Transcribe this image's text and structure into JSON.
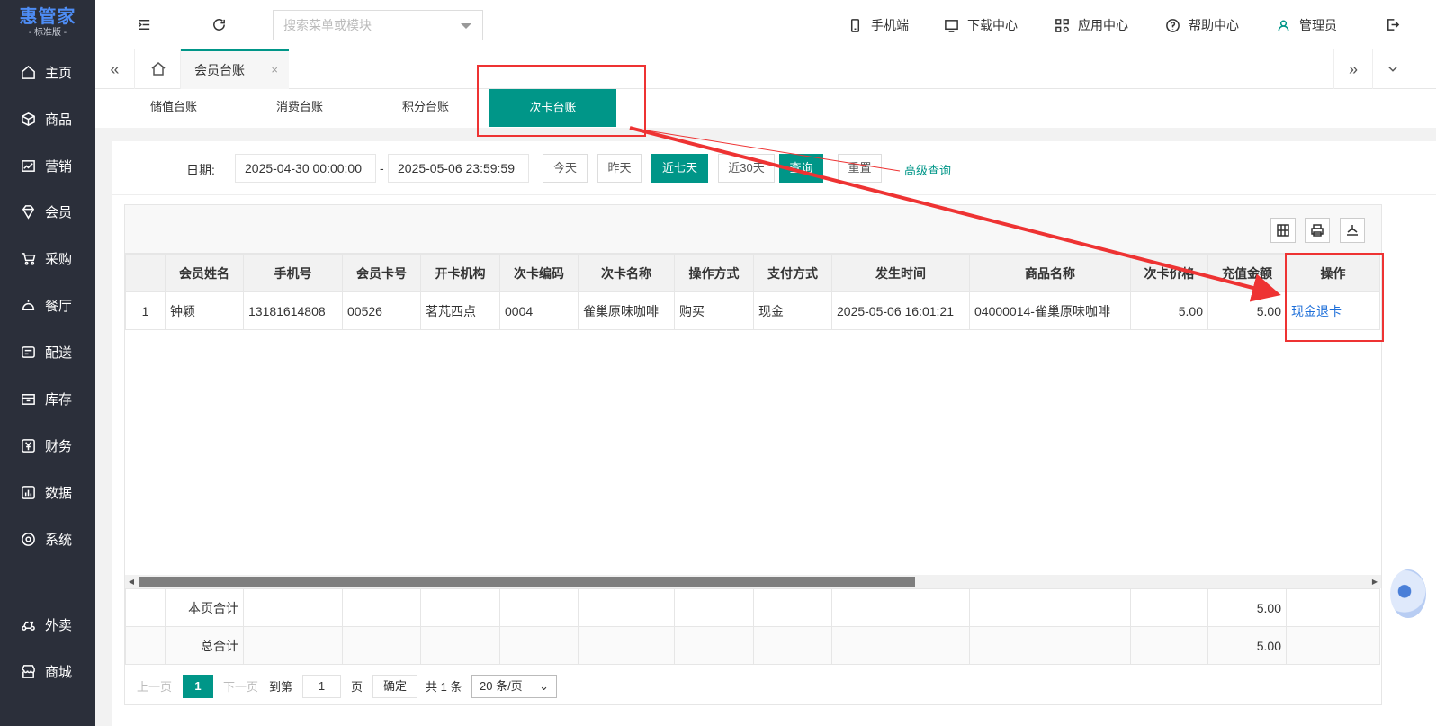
{
  "brand": {
    "name": "惠管家",
    "edition": "- 标准版 -"
  },
  "sidebar": {
    "items": [
      {
        "label": "主页",
        "icon": "home-icon"
      },
      {
        "label": "商品",
        "icon": "box-icon"
      },
      {
        "label": "营销",
        "icon": "chart-icon"
      },
      {
        "label": "会员",
        "icon": "diamond-icon"
      },
      {
        "label": "采购",
        "icon": "cart-icon"
      },
      {
        "label": "餐厅",
        "icon": "cloche-icon"
      },
      {
        "label": "配送",
        "icon": "delivery-icon"
      },
      {
        "label": "库存",
        "icon": "inventory-icon"
      },
      {
        "label": "财务",
        "icon": "yuan-icon"
      },
      {
        "label": "数据",
        "icon": "data-icon"
      },
      {
        "label": "系统",
        "icon": "settings-icon"
      },
      {
        "label": "外卖",
        "icon": "scooter-icon"
      },
      {
        "label": "商城",
        "icon": "shop-icon"
      }
    ]
  },
  "topbar": {
    "search_placeholder": "搜索菜单或模块",
    "links": [
      "手机端",
      "下载中心",
      "应用中心",
      "帮助中心",
      "管理员"
    ]
  },
  "tabbar": {
    "page_tab": "会员台账",
    "close": "×",
    "prev": "«",
    "next": "»",
    "more": "⌄"
  },
  "subtabs": [
    "储值台账",
    "消费台账",
    "积分台账",
    "次卡台账"
  ],
  "filter": {
    "date_label": "日期:",
    "start": "2025-04-30 00:00:00",
    "separator": "-",
    "end": "2025-05-06 23:59:59",
    "buttons": [
      "今天",
      "昨天",
      "近七天",
      "近30天"
    ],
    "query": "查询",
    "reset": "重置",
    "advanced": "高级查询"
  },
  "table": {
    "headers": [
      "会员姓名",
      "手机号",
      "会员卡号",
      "开卡机构",
      "次卡编码",
      "次卡名称",
      "操作方式",
      "支付方式",
      "发生时间",
      "商品名称",
      "次卡价格",
      "充值金额",
      "操作"
    ],
    "rows": [
      {
        "index": "1",
        "name": "钟颖",
        "phone": "13181614808",
        "card": "00526",
        "org": "茗芃西点",
        "code": "0004",
        "cardname": "雀巢原味咖啡",
        "op": "购买",
        "pay": "现金",
        "time": "2025-05-06 16:01:21",
        "goods": "04000014-雀巢原味咖啡",
        "price": "5.00",
        "amount": "5.00",
        "action": "现金退卡"
      }
    ],
    "footer": [
      {
        "label": "本页合计",
        "amount": "5.00"
      },
      {
        "label": "总合计",
        "amount": "5.00"
      }
    ]
  },
  "pager": {
    "prev": "上一页",
    "current": "1",
    "next": "下一页",
    "goto": "到第",
    "page_input": "1",
    "page_unit": "页",
    "confirm": "确定",
    "total": "共 1 条",
    "per_page": "20 条/页"
  },
  "colors": {
    "accent": "#009688",
    "sidebar": "#2b2f3a",
    "annotation": "#ee3333",
    "link": "#1e6fd9"
  }
}
